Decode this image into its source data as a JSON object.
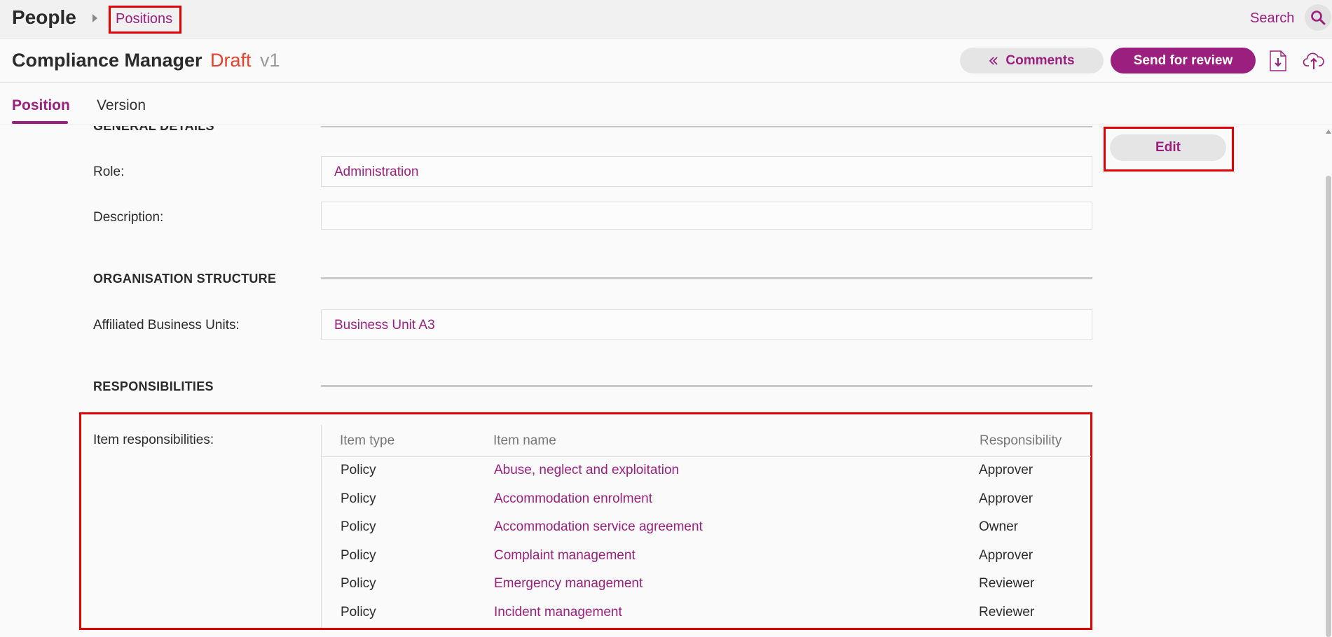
{
  "topbar": {
    "app_title": "People",
    "breadcrumb": "Positions",
    "search_label": "Search",
    "search_icon": "search-icon"
  },
  "header": {
    "title": "Compliance Manager",
    "status": "Draft",
    "version": "v1",
    "comments_label": "Comments",
    "send_label": "Send for review",
    "icons": [
      "chevrons-left-icon",
      "download-file-icon",
      "upload-cloud-icon"
    ]
  },
  "tabs": [
    {
      "label": "Position",
      "active": true
    },
    {
      "label": "Version",
      "active": false
    }
  ],
  "sections": {
    "general": {
      "heading": "GENERAL DETAILS",
      "role_label": "Role:",
      "role_value": "Administration",
      "description_label": "Description:",
      "description_value": ""
    },
    "org": {
      "heading": "ORGANISATION STRUCTURE",
      "units_label": "Affiliated Business Units:",
      "units_value": "Business Unit A3"
    },
    "responsibilities": {
      "heading": "RESPONSIBILITIES",
      "items_label": "Item responsibilities:",
      "columns": [
        "Item type",
        "Item name",
        "Responsibility"
      ],
      "rows": [
        {
          "type": "Policy",
          "name": "Abuse, neglect and exploitation",
          "responsibility": "Approver"
        },
        {
          "type": "Policy",
          "name": "Accommodation enrolment",
          "responsibility": "Approver"
        },
        {
          "type": "Policy",
          "name": "Accommodation service agreement",
          "responsibility": "Owner"
        },
        {
          "type": "Policy",
          "name": "Complaint management",
          "responsibility": "Approver"
        },
        {
          "type": "Policy",
          "name": "Emergency management",
          "responsibility": "Reviewer"
        },
        {
          "type": "Policy",
          "name": "Incident management",
          "responsibility": "Reviewer"
        }
      ]
    }
  },
  "edit_label": "Edit",
  "colors": {
    "accent": "#9b1f7f",
    "draft": "#e8402a",
    "highlight": "#e30000"
  }
}
